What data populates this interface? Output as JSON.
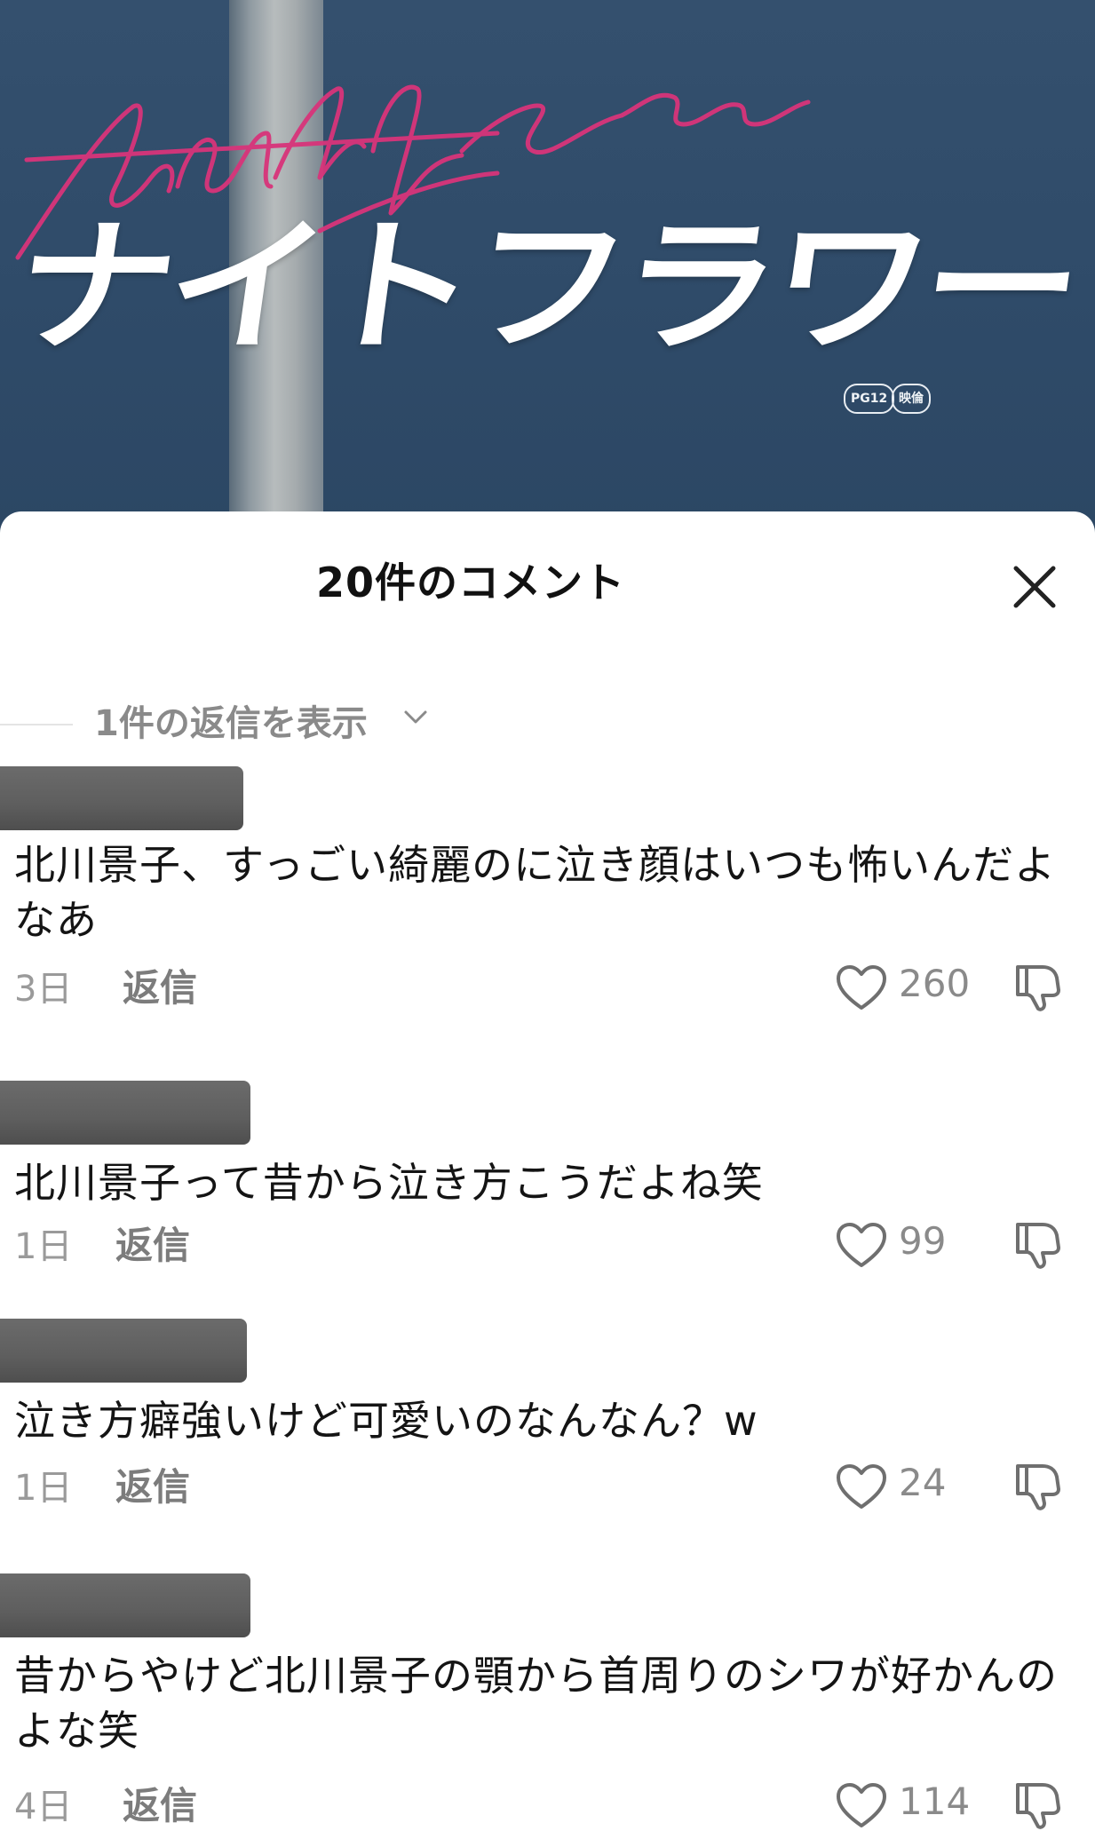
{
  "video": {
    "title_jp": "ナイトフラワー",
    "title_script": "Night Flower",
    "rating_badges": [
      "PG12",
      "映倫"
    ]
  },
  "sheet": {
    "title": "20件のコメント",
    "close_icon": "close-icon",
    "show_replies": "1件の返信を表示"
  },
  "comments": [
    {
      "text": "北川景子、すっごい綺麗のに泣き顔はいつも怖いんだよなあ",
      "date": "3日",
      "reply_label": "返信",
      "likes": "260"
    },
    {
      "text": "北川景子って昔から泣き方こうだよね笑",
      "date": "1日",
      "reply_label": "返信",
      "likes": "99"
    },
    {
      "text": "泣き方癖強いけど可愛いのなんなん？w",
      "date": "1日",
      "reply_label": "返信",
      "likes": "24"
    },
    {
      "text": "昔からやけど北川景子の顎から首周りのシワが好かんのよな笑",
      "date": "4日",
      "reply_label": "返信",
      "likes": "114"
    }
  ],
  "colors": {
    "video_bg": "#2f4b69",
    "script_pink": "#d8347a",
    "name_redaction": "#5e5e5e"
  }
}
